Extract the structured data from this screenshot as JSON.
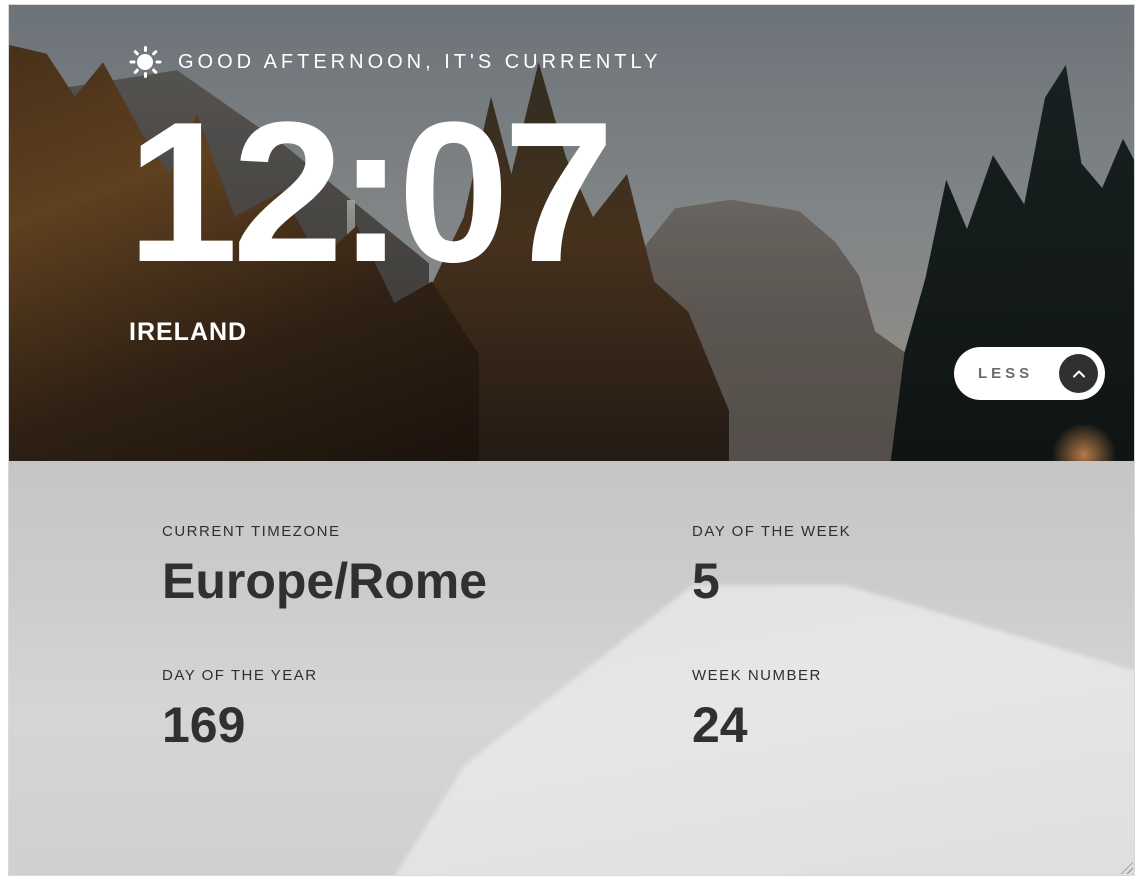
{
  "header": {
    "icon": "sun-icon",
    "greeting": "GOOD AFTERNOON, IT'S CURRENTLY",
    "time": "12:07",
    "location": "IRELAND"
  },
  "toggle": {
    "label": "LESS",
    "icon": "chevron-up-icon"
  },
  "details": [
    {
      "label": "CURRENT TIMEZONE",
      "value": "Europe/Rome"
    },
    {
      "label": "DAY OF THE WEEK",
      "value": "5"
    },
    {
      "label": "DAY OF THE YEAR",
      "value": "169"
    },
    {
      "label": "WEEK NUMBER",
      "value": "24"
    }
  ],
  "colors": {
    "text_light": "#ffffff",
    "text_dark": "#303030",
    "button_bg": "#ffffff",
    "button_icon_bg": "#303030",
    "panel_bg": "#e4e5e7"
  }
}
